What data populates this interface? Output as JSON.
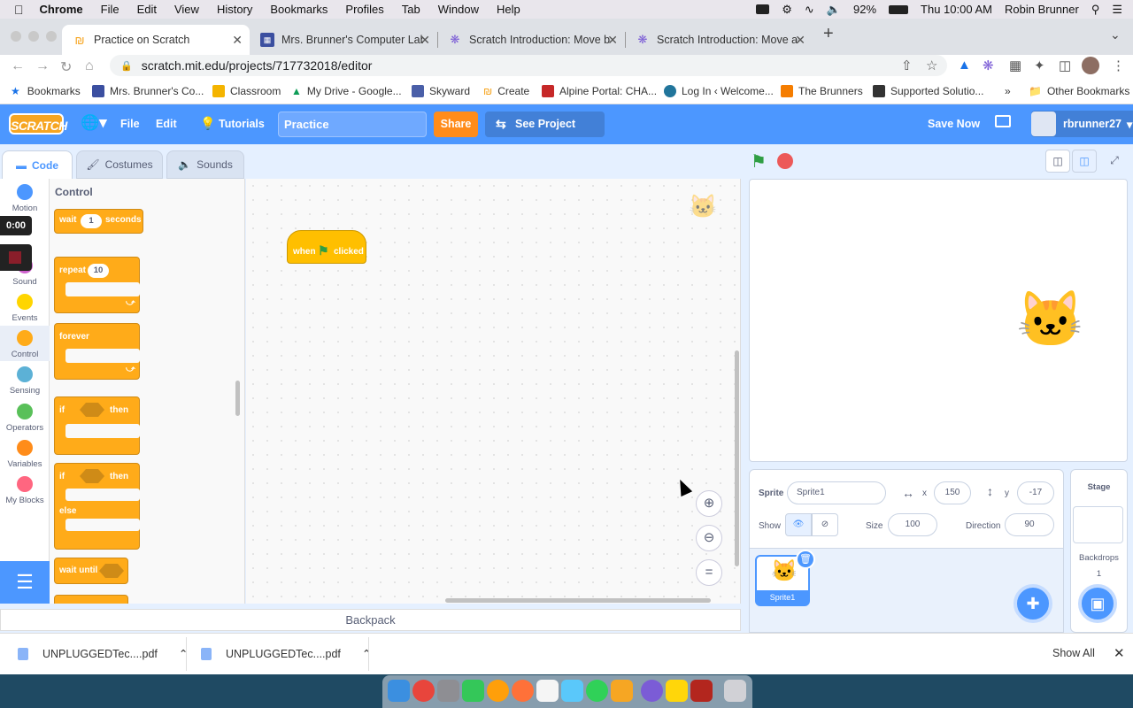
{
  "menubar": {
    "app": "Chrome",
    "items": [
      "File",
      "Edit",
      "View",
      "History",
      "Bookmarks",
      "Profiles",
      "Tab",
      "Window",
      "Help"
    ],
    "battery": "92%",
    "clock": "Thu 10:00 AM",
    "user": "Robin Brunner"
  },
  "tabs": [
    {
      "title": "Practice on Scratch",
      "icon": "scratch-cat-icon"
    },
    {
      "title": "Mrs. Brunner's Computer Lab",
      "icon": "site-icon"
    },
    {
      "title": "Scratch Introduction: Move bac",
      "icon": "scratch-sun-icon"
    },
    {
      "title": "Scratch Introduction: Move acr",
      "icon": "scratch-sun-icon"
    }
  ],
  "address": {
    "url": "scratch.mit.edu/projects/717732018/editor"
  },
  "bookmarks": [
    "Bookmarks",
    "Mrs. Brunner's Co...",
    "Classroom",
    "My Drive - Google...",
    "Skyward",
    "Create",
    "Alpine Portal: CHA...",
    "Log In ‹ Welcome...",
    "The Brunners",
    "Supported Solutio...",
    "»",
    "Other Bookmarks"
  ],
  "scratch": {
    "logo": "SCRATCH",
    "menu": {
      "file": "File",
      "edit": "Edit",
      "tutorials": "Tutorials",
      "project_title": "Practice",
      "share": "Share",
      "see_project": "See Project Page",
      "save_now": "Save Now",
      "username": "rbrunner27"
    },
    "editor_tabs": [
      "Code",
      "Costumes",
      "Sounds"
    ],
    "categories": [
      {
        "name": "Motion",
        "color": "#4c97ff"
      },
      {
        "name": "Sound",
        "color": "#cf63cf"
      },
      {
        "name": "Events",
        "color": "#ffd500"
      },
      {
        "name": "Control",
        "color": "#ffab19"
      },
      {
        "name": "Sensing",
        "color": "#5cb1d6"
      },
      {
        "name": "Operators",
        "color": "#59c059"
      },
      {
        "name": "Variables",
        "color": "#ff8c1a"
      },
      {
        "name": "My Blocks",
        "color": "#ff6680"
      }
    ],
    "palette": {
      "title": "Control",
      "wait": {
        "label": "wait",
        "value": "1",
        "unit": "seconds"
      },
      "repeat": {
        "label": "repeat",
        "value": "10"
      },
      "forever": "forever",
      "if_then": {
        "if": "if",
        "then": "then"
      },
      "if_else": {
        "if": "if",
        "then": "then",
        "else": "else"
      },
      "wait_until": "wait until"
    },
    "workspace": {
      "hat_when": "when",
      "hat_clicked": "clicked"
    },
    "backpack": "Backpack",
    "sprite_info": {
      "sprite_label": "Sprite",
      "sprite_name": "Sprite1",
      "x_label": "x",
      "x": "150",
      "y_label": "y",
      "y": "-17",
      "show_label": "Show",
      "size_label": "Size",
      "size": "100",
      "direction_label": "Direction",
      "direction": "90"
    },
    "sprite_card": "Sprite1",
    "stage_panel": {
      "title": "Stage",
      "backdrops_label": "Backdrops",
      "backdrops_count": "1"
    }
  },
  "recording": {
    "timer": "0:00"
  },
  "downloads": {
    "files": [
      "UNPLUGGEDTec....pdf",
      "UNPLUGGEDTec....pdf"
    ],
    "show_all": "Show All"
  }
}
